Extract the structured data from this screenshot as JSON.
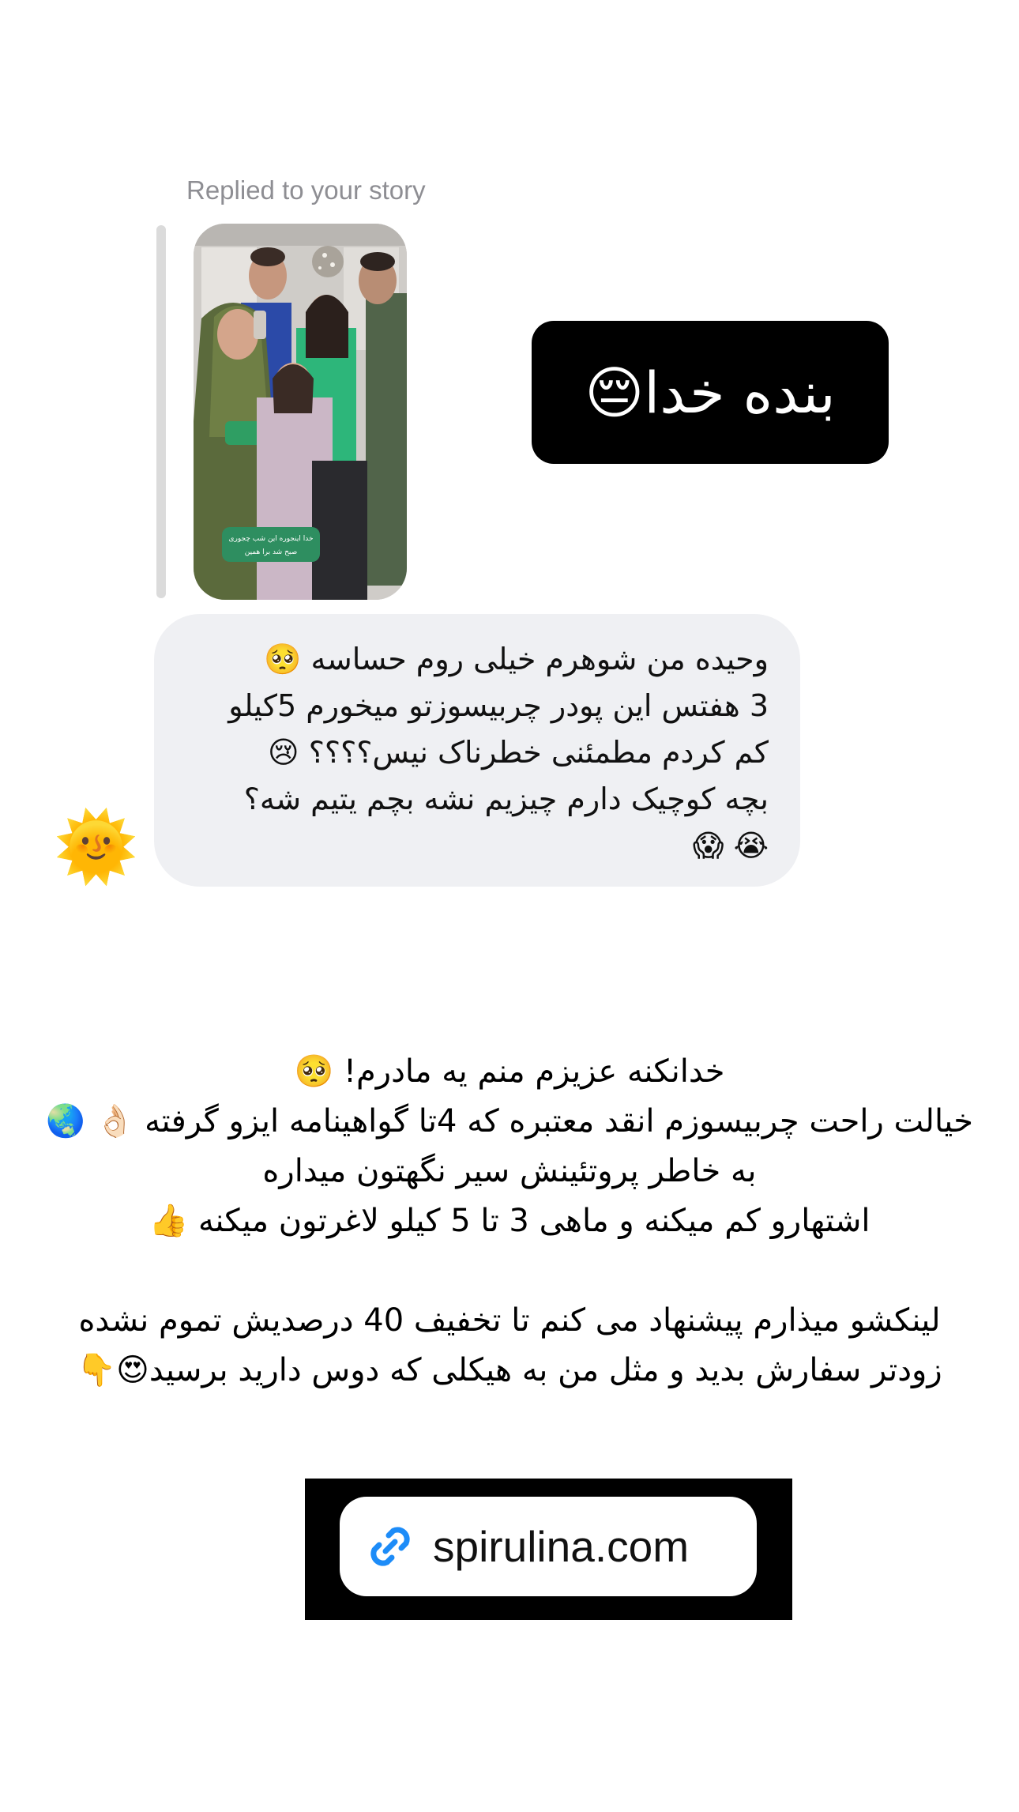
{
  "reply_header": {
    "label": "Replied to your story"
  },
  "story": {
    "sticker_line1": "خدا اینجوره این شب چجوری",
    "sticker_line2": "صبح شد برا همین"
  },
  "sticker": {
    "text": "بنده خدا😔"
  },
  "message": {
    "lines": [
      "وحیده من شوهرم خیلی روم حساسه 🥺",
      "3 هفتس این پودر چربیسوزتو میخورم 5کیلو",
      "کم کردم مطمئنی خطرناک نیس؟؟؟؟ 😢",
      "بچه کوچیک دارم چیزیم نشه بچم یتیم شه؟",
      "😭 😱"
    ]
  },
  "avatar": {
    "emoji": "🌞"
  },
  "caption": {
    "lines": [
      "خدانکنه عزیزم منم یه مادرم! 🥺",
      "خیالت راحت چربیسوزم انقد معتبره که 4تا گواهینامه ایزو گرفته 👌🏻 🌏",
      "به خاطر پروتئینش سیر نگهتون میداره",
      "اشتهارو کم میکنه و ماهی 3 تا 5 کیلو لاغرتون میکنه 👍",
      "",
      "لینکشو میذارم پیشنهاد می کنم تا تخفیف 40 درصدیش تموم نشده",
      "زودتر سفارش بدید و مثل من به هیکلی که دوس دارید برسید😍👇"
    ]
  },
  "link_sticker": {
    "icon": "link-icon",
    "text": "spirulina.com",
    "icon_color": "#1d8cf8"
  }
}
